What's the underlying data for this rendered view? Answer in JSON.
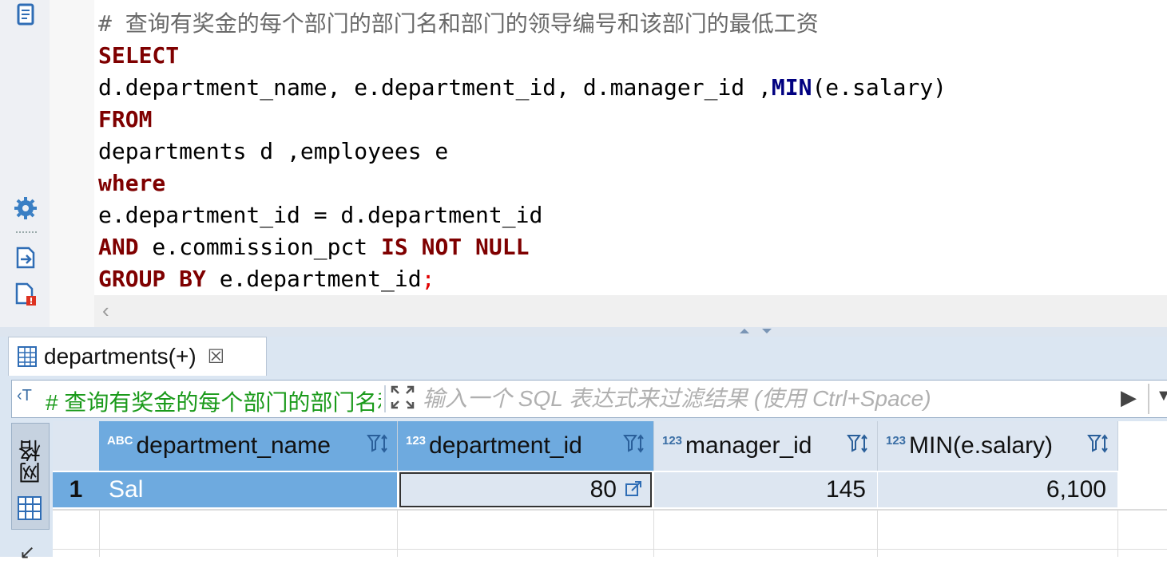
{
  "editor": {
    "lines": [
      {
        "parts": [
          {
            "t": "# 查询有奖金的每个部门的部门名和部门的领导编号和该部门的最低工资",
            "c": "cm"
          }
        ]
      },
      {
        "parts": [
          {
            "t": "SELECT",
            "c": "kw"
          }
        ]
      },
      {
        "parts": [
          {
            "t": "d.department_name, e.department_id, d.manager_id ,",
            "c": ""
          },
          {
            "t": "MIN",
            "c": "fn"
          },
          {
            "t": "(e.salary)",
            "c": ""
          }
        ]
      },
      {
        "parts": [
          {
            "t": "FROM",
            "c": "kw"
          }
        ]
      },
      {
        "parts": [
          {
            "t": "departments d ,employees e",
            "c": ""
          }
        ]
      },
      {
        "parts": [
          {
            "t": "where",
            "c": "kw"
          }
        ]
      },
      {
        "parts": [
          {
            "t": "e.department_id = d.department_id",
            "c": ""
          }
        ]
      },
      {
        "parts": [
          {
            "t": "AND",
            "c": "kw"
          },
          {
            "t": " e.commission_pct ",
            "c": ""
          },
          {
            "t": "IS NOT NULL",
            "c": "kw"
          }
        ]
      },
      {
        "parts": [
          {
            "t": "GROUP BY",
            "c": "kw"
          },
          {
            "t": " e.department_id",
            "c": ""
          },
          {
            "t": ";",
            "c": "semi"
          }
        ]
      }
    ]
  },
  "results": {
    "tab_label": "departments(+)",
    "filter_query": "# 查询有奖金的每个部门的部门名和部门的",
    "filter_placeholder": "输入一个 SQL 表达式来过滤结果 (使用 Ctrl+Space)",
    "side_tab_label": "网格",
    "columns": [
      {
        "type": "ABC",
        "label": "department_name"
      },
      {
        "type": "123",
        "label": "department_id"
      },
      {
        "type": "123",
        "label": "manager_id"
      },
      {
        "type": "123",
        "label": "MIN(e.salary)"
      }
    ],
    "rows": [
      {
        "num": "1",
        "cells": [
          "Sal",
          "80",
          "145",
          "6,100"
        ]
      }
    ]
  },
  "colors": {
    "keyword": "#7f0000",
    "function": "#000080",
    "comment": "#6a6a6a",
    "selected_header": "#6eaadf",
    "filter_green": "#1a9a1a"
  }
}
